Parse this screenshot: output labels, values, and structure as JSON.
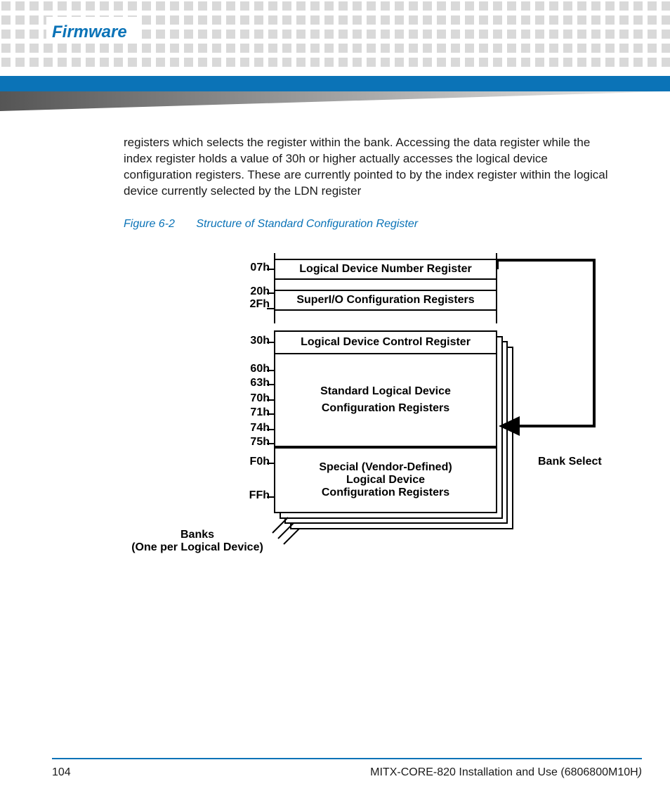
{
  "header": {
    "title": "Firmware"
  },
  "body": {
    "paragraph": "registers which selects the register within the bank. Accessing the data register while the index register holds a value of 30h or higher actually accesses the logical device configuration registers. These are currently pointed to by the index register within the logical device currently selected by the LDN register"
  },
  "figure": {
    "number": "Figure 6-2",
    "title": "Structure of Standard Configuration Register",
    "addresses": {
      "a07": "07h",
      "a20": "20h",
      "a2f": "2Fh",
      "a30": "30h",
      "a60": "60h",
      "a63": "63h",
      "a70": "70h",
      "a71": "71h",
      "a74": "74h",
      "a75": "75h",
      "af0": "F0h",
      "aff": "FFh"
    },
    "boxes": {
      "ldn": "Logical Device Number Register",
      "superio": "SuperI/O Configuration Registers",
      "control": "Logical Device Control Register",
      "standard_l1": "Standard Logical Device",
      "standard_l2": "Configuration Registers",
      "special_l1": "Special (Vendor-Defined)",
      "special_l2": "Logical Device",
      "special_l3": "Configuration Registers"
    },
    "labels": {
      "banks_l1": "Banks",
      "banks_l2": "(One per Logical Device)",
      "bank_select": "Bank Select"
    }
  },
  "footer": {
    "page": "104",
    "doc": "MITX-CORE-820 Installation and Use (6806800M10H",
    "close": ")"
  }
}
